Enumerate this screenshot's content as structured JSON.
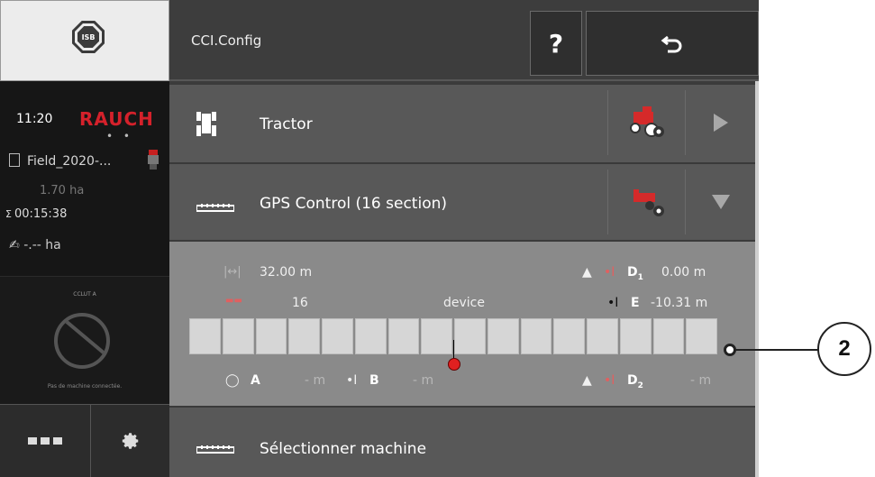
{
  "left_panel": {
    "isb_label": "ISB",
    "time": "11:20",
    "brand": "RAUCH",
    "brand_dots": "• •",
    "field_name": "Field_2020-...",
    "area": "1.70 ha",
    "timer_prefix": "Σ",
    "timer": "00:15:38",
    "worked_area": "-.-- ha",
    "cclut_title": "CCLUT A",
    "cclut_message": "Pas de machine connectée."
  },
  "header": {
    "title": "CCI.Config",
    "help_label": "?"
  },
  "rows": {
    "tractor": "Tractor",
    "gps_control": "GPS Control (16 section)",
    "select_machine": "Sélectionner machine"
  },
  "gps": {
    "width_value": "32.00 m",
    "sections_value": "16",
    "position_label": "device",
    "d1_label": "D",
    "d1_sub": "1",
    "d1_value": "0.00 m",
    "e_label": "E",
    "e_value": "-10.31 m",
    "a_label": "A",
    "a_value": "- m",
    "b_label": "B",
    "b_value": "- m",
    "d2_label": "D",
    "d2_sub": "2",
    "d2_value": "- m",
    "section_count": 16,
    "device_fraction": 0.5
  },
  "callout": {
    "number": "2"
  },
  "colors": {
    "brand_red": "#d5212b",
    "dot_red": "#e02020"
  }
}
